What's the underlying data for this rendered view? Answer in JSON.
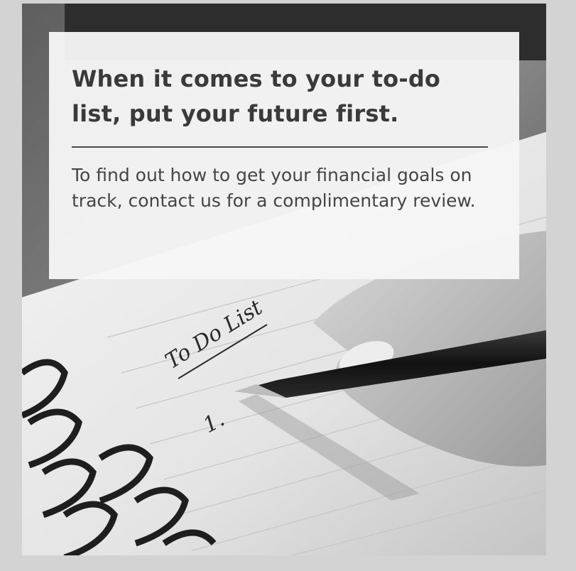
{
  "card": {
    "headline": "When it comes to your to-do list, put your future first.",
    "body": "To find out how to get your financial goals on track, contact us for a complimentary review."
  },
  "photo": {
    "notebook_title": "To Do List",
    "first_item_number": "1."
  },
  "colors": {
    "frame": "#d3d3d3",
    "card_background": "#f6f6f6",
    "headline": "#3a3a3a",
    "body_text": "#454545"
  }
}
